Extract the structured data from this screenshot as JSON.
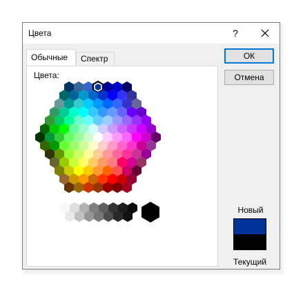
{
  "dialog": {
    "title": "Цвета",
    "help_glyph": "?",
    "tabs": [
      {
        "label": "Обычные",
        "active": true
      },
      {
        "label": "Спектр",
        "active": false
      }
    ],
    "colors_label": "Цвета:",
    "ok_label": "ОК",
    "cancel_label": "Отмена",
    "new_label": "Новый",
    "current_label": "Текущий",
    "new_color": "#003399",
    "current_color": "#000000",
    "selected_color": "#003399"
  },
  "palette": {
    "rows": [
      [
        "#003366",
        "#336699",
        "#3366cc",
        "#003399",
        "#000099",
        "#0000cc",
        "#000066"
      ],
      [
        "#006666",
        "#006699",
        "#0099cc",
        "#0066cc",
        "#0033cc",
        "#0000ff",
        "#3333ff",
        "#333399"
      ],
      [
        "#669999",
        "#009999",
        "#33cccc",
        "#00ccff",
        "#0099ff",
        "#0066ff",
        "#3366ff",
        "#3333cc",
        "#666699"
      ],
      [
        "#339966",
        "#00cc99",
        "#00ffcc",
        "#00ffff",
        "#33ccff",
        "#3399ff",
        "#6699ff",
        "#6666ff",
        "#6600ff",
        "#6600cc"
      ],
      [
        "#339933",
        "#00cc66",
        "#00ff99",
        "#66ffcc",
        "#66ffff",
        "#66ccff",
        "#99ccff",
        "#9999ff",
        "#9966ff",
        "#9933ff",
        "#9900ff"
      ],
      [
        "#006600",
        "#00cc00",
        "#00ff00",
        "#66ff99",
        "#99ffcc",
        "#ccffff",
        "#ccccff",
        "#cc99ff",
        "#cc66ff",
        "#cc33ff",
        "#cc00ff",
        "#9900cc"
      ],
      [
        "#003300",
        "#009933",
        "#33cc33",
        "#66ff66",
        "#99ff99",
        "#ccffcc",
        "#ffffff",
        "#ffccff",
        "#ff99ff",
        "#ff66ff",
        "#ff00ff",
        "#cc00cc",
        "#660066"
      ],
      [
        "#336600",
        "#009900",
        "#66ff33",
        "#99ff66",
        "#ccff99",
        "#ffffcc",
        "#ffcccc",
        "#ff99cc",
        "#ff66cc",
        "#ff33cc",
        "#cc0099",
        "#993399"
      ],
      [
        "#333300",
        "#669900",
        "#99ff33",
        "#ccff66",
        "#ffff99",
        "#ffcc99",
        "#ff9999",
        "#ff6699",
        "#ff3399",
        "#cc3399",
        "#990099"
      ],
      [
        "#666633",
        "#99cc00",
        "#ccff33",
        "#ffff66",
        "#ffcc66",
        "#ff9966",
        "#ff7c80",
        "#ff0066",
        "#d60093",
        "#993366"
      ],
      [
        "#808000",
        "#cccc00",
        "#ffff00",
        "#ffcc00",
        "#ff9933",
        "#ff6600",
        "#ff5050",
        "#cc0066",
        "#660033"
      ],
      [
        "#996633",
        "#cc9900",
        "#ff9900",
        "#cc6600",
        "#ff3300",
        "#ff0000",
        "#cc0000",
        "#990033"
      ],
      [
        "#663300",
        "#996600",
        "#cc3300",
        "#993300",
        "#990000",
        "#800000",
        "#a50021"
      ]
    ],
    "grays": [
      "#f8f8f8",
      "#dddddd",
      "#b2b2b2",
      "#808080",
      "#5f5f5f",
      "#333333",
      "#1c1c1c",
      "#080808"
    ],
    "gray_rows_top": [
      "#eaeaea",
      "#c0c0c0",
      "#969696",
      "#777777",
      "#4d4d4d",
      "#292929",
      "#111111"
    ],
    "black": "#000000"
  }
}
